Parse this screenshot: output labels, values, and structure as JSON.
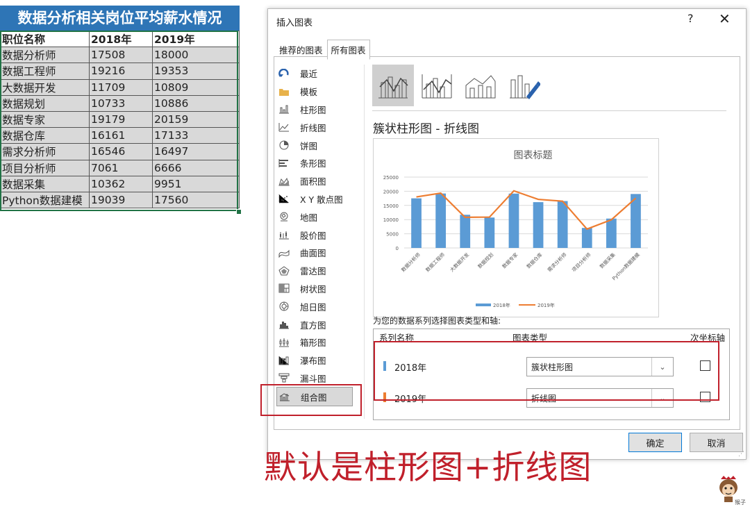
{
  "sheet": {
    "title": "数据分析相关岗位平均薪水情况",
    "headers": [
      "职位名称",
      "2018年",
      "2019年"
    ],
    "rows": [
      [
        "数据分析师",
        "17508",
        "18000"
      ],
      [
        "数据工程师",
        "19216",
        "19353"
      ],
      [
        "大数据开发",
        "11709",
        "10809"
      ],
      [
        "数据规划",
        "10733",
        "10886"
      ],
      [
        "数据专家",
        "19179",
        "20159"
      ],
      [
        "数据仓库",
        "16161",
        "17133"
      ],
      [
        "需求分析师",
        "16546",
        "16497"
      ],
      [
        "项目分析师",
        "7061",
        "6666"
      ],
      [
        "数据采集",
        "10362",
        "9951"
      ],
      [
        "Python数据建模",
        "19039",
        "17560"
      ]
    ]
  },
  "dialog": {
    "title": "插入图表",
    "help": "?",
    "close": "✕",
    "tabs": [
      "推荐的图表",
      "所有图表"
    ],
    "chart_types": [
      {
        "label": "最近",
        "icon": "recent-icon"
      },
      {
        "label": "模板",
        "icon": "folder-icon"
      },
      {
        "label": "柱形图",
        "icon": "column-chart-icon"
      },
      {
        "label": "折线图",
        "icon": "line-chart-icon"
      },
      {
        "label": "饼图",
        "icon": "pie-chart-icon"
      },
      {
        "label": "条形图",
        "icon": "bar-chart-icon"
      },
      {
        "label": "面积图",
        "icon": "area-chart-icon"
      },
      {
        "label": "X Y 散点图",
        "icon": "scatter-chart-icon"
      },
      {
        "label": "地图",
        "icon": "map-chart-icon"
      },
      {
        "label": "股价图",
        "icon": "stock-chart-icon"
      },
      {
        "label": "曲面图",
        "icon": "surface-chart-icon"
      },
      {
        "label": "雷达图",
        "icon": "radar-chart-icon"
      },
      {
        "label": "树状图",
        "icon": "treemap-chart-icon"
      },
      {
        "label": "旭日图",
        "icon": "sunburst-chart-icon"
      },
      {
        "label": "直方图",
        "icon": "histogram-chart-icon"
      },
      {
        "label": "箱形图",
        "icon": "box-chart-icon"
      },
      {
        "label": "瀑布图",
        "icon": "waterfall-chart-icon"
      },
      {
        "label": "漏斗图",
        "icon": "funnel-chart-icon"
      },
      {
        "label": "组合图",
        "icon": "combo-chart-icon"
      }
    ],
    "selected_type": "组合图",
    "subtype_title": "簇状柱形图 - 折线图",
    "series_prompt": "为您的数据系列选择图表类型和轴:",
    "series_headers": {
      "name": "系列名称",
      "type": "图表类型",
      "axis": "次坐标轴"
    },
    "series": [
      {
        "name": "2018年",
        "type": "簇状柱形图",
        "color": "#5B9BD5",
        "secondary": false
      },
      {
        "name": "2019年",
        "type": "折线图",
        "color": "#ED7D31",
        "secondary": false
      }
    ],
    "ok": "确定",
    "cancel": "取消"
  },
  "chart_data": {
    "type": "bar",
    "title": "图表标题",
    "categories": [
      "数据分析师",
      "数据工程师",
      "大数据开发",
      "数据规划",
      "数据专家",
      "数据仓库",
      "需求分析师",
      "项目分析师",
      "数据采集",
      "Python数据建模"
    ],
    "series": [
      {
        "name": "2018年",
        "type": "bar",
        "color": "#5B9BD5",
        "values": [
          17508,
          19216,
          11709,
          10733,
          19179,
          16161,
          16546,
          7061,
          10362,
          19039
        ]
      },
      {
        "name": "2019年",
        "type": "line",
        "color": "#ED7D31",
        "values": [
          18000,
          19353,
          10809,
          10886,
          20159,
          17133,
          16497,
          6666,
          9951,
          17560
        ]
      }
    ],
    "ylim": [
      0,
      25000
    ],
    "yticks": [
      0,
      5000,
      10000,
      15000,
      20000,
      25000
    ],
    "grid": true,
    "legend": "bottom"
  },
  "caption": "默认是柱形图+折线图",
  "logo_text": "猴子"
}
